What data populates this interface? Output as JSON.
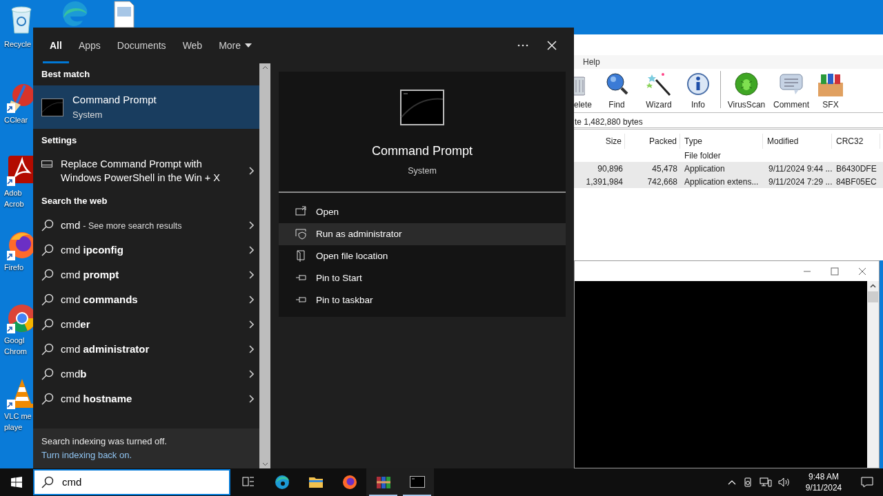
{
  "desktop": {
    "top_icons": [
      {
        "kind": "edge"
      },
      {
        "kind": "document"
      }
    ],
    "icons": [
      {
        "kind": "recycle-bin",
        "lines": [
          "Recycle"
        ]
      },
      {
        "kind": "cleaner",
        "lines": [
          "CClear"
        ]
      },
      {
        "kind": "pdf",
        "lines": [
          "Adob",
          "Acrob"
        ]
      },
      {
        "kind": "firefox",
        "lines": [
          "Firefo"
        ]
      },
      {
        "kind": "chrome",
        "lines": [
          "Googl",
          "Chrom"
        ]
      },
      {
        "kind": "vlc",
        "lines": [
          "VLC me",
          "playe"
        ]
      }
    ]
  },
  "archive_window": {
    "menu": [
      "Help"
    ],
    "toolbar": [
      {
        "kind": "delete",
        "label": "elete"
      },
      {
        "kind": "find",
        "label": "Find"
      },
      {
        "kind": "wizard",
        "label": "Wizard"
      },
      {
        "kind": "info",
        "label": "Info"
      },
      {
        "kind": "virus",
        "label": "VirusScan"
      },
      {
        "kind": "comment",
        "label": "Comment"
      },
      {
        "kind": "sfx",
        "label": "SFX"
      }
    ],
    "info": "te 1,482,880 bytes",
    "columns": [
      "Size",
      "Packed",
      "Type",
      "Modified",
      "CRC32"
    ],
    "rows": [
      {
        "type": "File folder",
        "selected": false
      },
      {
        "size": "90,896",
        "packed": "45,478",
        "type": "Application",
        "modified": "9/11/2024 9:44 ...",
        "crc32": "B6430DFE",
        "selected": true
      },
      {
        "size": "1,391,984",
        "packed": "742,668",
        "type": "Application extens...",
        "modified": "9/11/2024 7:29 ...",
        "crc32": "84BF05EC",
        "selected": true
      }
    ]
  },
  "search_panel": {
    "tabs": [
      {
        "label": "All",
        "selected": true,
        "dropdown": false
      },
      {
        "label": "Apps",
        "selected": false,
        "dropdown": false
      },
      {
        "label": "Documents",
        "selected": false,
        "dropdown": false
      },
      {
        "label": "Web",
        "selected": false,
        "dropdown": false
      },
      {
        "label": "More",
        "selected": false,
        "dropdown": true
      }
    ],
    "best_match": {
      "heading": "Best match",
      "title": "Command Prompt",
      "subtitle": "System",
      "selected": true
    },
    "settings": {
      "heading": "Settings",
      "items": [
        {
          "text": "Replace Command Prompt with Windows PowerShell in the Win + X"
        }
      ]
    },
    "web": {
      "heading": "Search the web",
      "items": [
        {
          "text": "cmd",
          "note": "- See more search results"
        },
        {
          "text": "cmd **ipconfig**"
        },
        {
          "text": "cmd **prompt**"
        },
        {
          "text": "cmd **commands**"
        },
        {
          "text": "cmd**er**"
        },
        {
          "text": "cmd **administrator**"
        },
        {
          "text": "cmd**b**"
        },
        {
          "text": "cmd **hostname**"
        }
      ]
    },
    "footer": {
      "message": "Search indexing was turned off.",
      "link": "Turn indexing back on."
    },
    "preview": {
      "title": "Command Prompt",
      "subtitle": "System",
      "actions": [
        {
          "kind": "open",
          "label": "Open",
          "highlighted": false
        },
        {
          "kind": "admin",
          "label": "Run as administrator",
          "highlighted": true
        },
        {
          "kind": "folder",
          "label": "Open file location",
          "highlighted": false
        },
        {
          "kind": "pin",
          "label": "Pin to Start",
          "highlighted": false
        },
        {
          "kind": "pin",
          "label": "Pin to taskbar",
          "highlighted": false
        }
      ]
    }
  },
  "taskbar": {
    "search": {
      "value": "cmd"
    },
    "apps": [
      {
        "kind": "task-view",
        "active": false
      },
      {
        "kind": "edge",
        "active": false
      },
      {
        "kind": "explorer",
        "active": false
      },
      {
        "kind": "firefox",
        "active": false
      },
      {
        "kind": "archiver",
        "active": true
      },
      {
        "kind": "console",
        "active": true
      }
    ],
    "clock": {
      "time": "9:48 AM",
      "date": "9/11/2024"
    }
  }
}
